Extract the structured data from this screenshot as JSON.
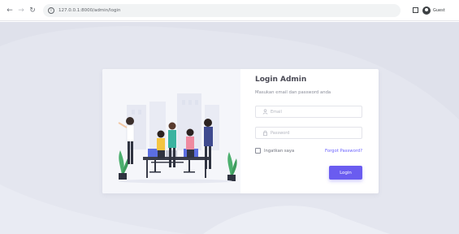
{
  "browser": {
    "url": "127.0.0.1:8000/admin/login",
    "profile_label": "Guest",
    "icons": [
      "back-arrow-icon",
      "forward-arrow-icon",
      "reload-icon",
      "site-info-icon",
      "tab-search-icon",
      "guest-profile-icon"
    ]
  },
  "login": {
    "title": "Login Admin",
    "subtitle": "Masukan email dan password anda",
    "email_placeholder": "Email",
    "password_placeholder": "Password",
    "remember_label": "Ingatkan saya",
    "forgot_label": "Forgot Password?",
    "submit_label": "Login"
  },
  "colors": {
    "page_background": "#e4e6ef",
    "accent": "#6a5cf0",
    "link": "#6c63ff",
    "title": "#4a4a55"
  }
}
